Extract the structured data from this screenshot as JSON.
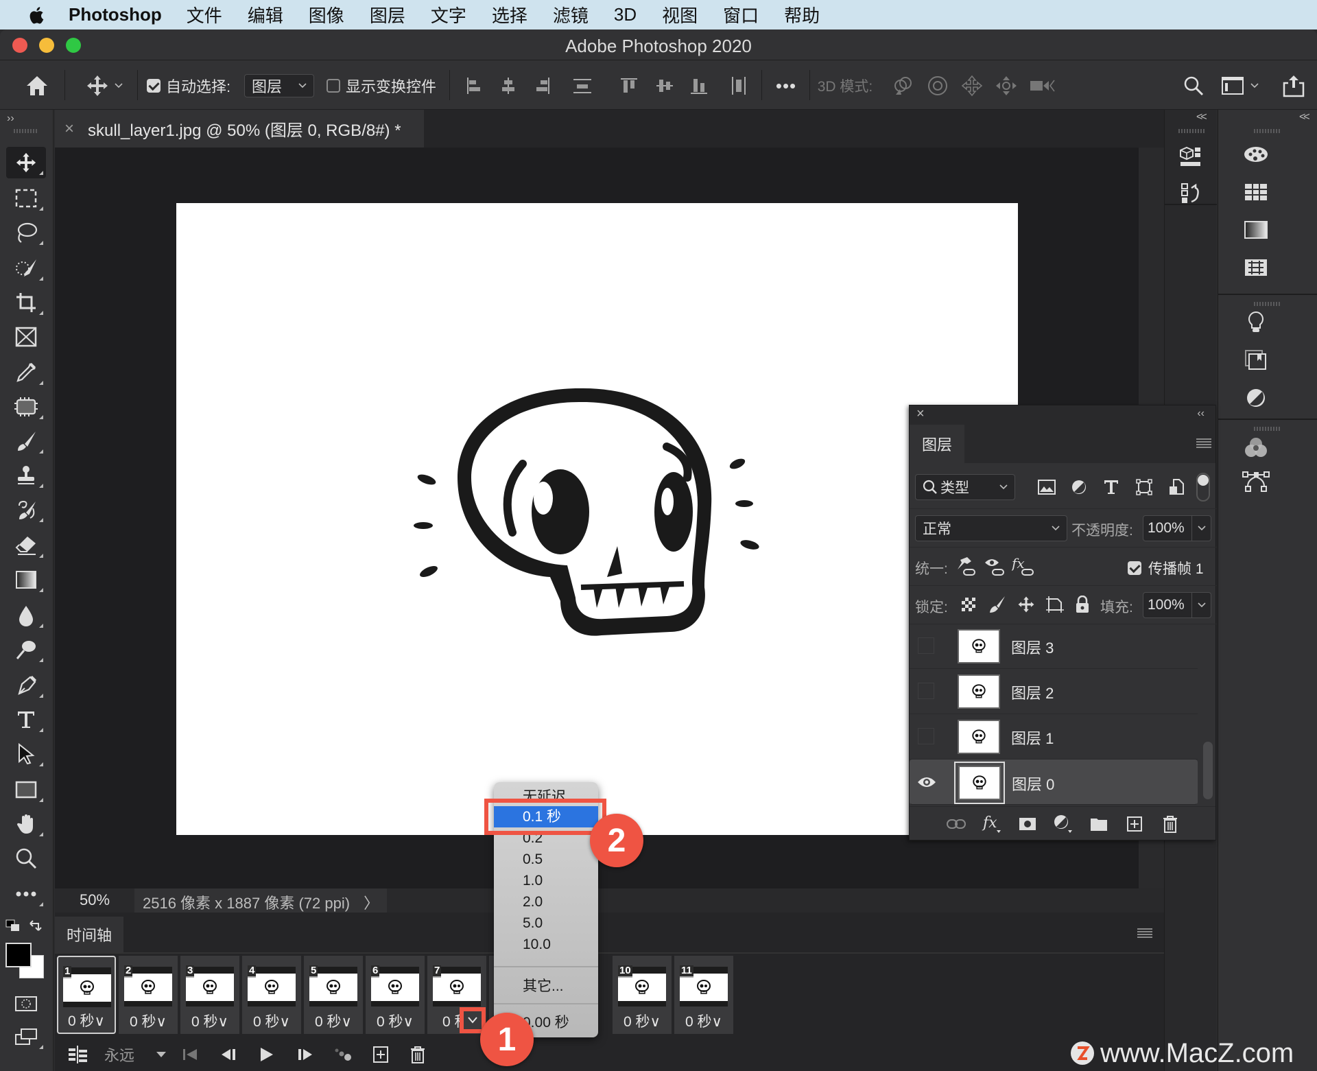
{
  "menubar": {
    "app": "Photoshop",
    "items": [
      "文件",
      "编辑",
      "图像",
      "图层",
      "文字",
      "选择",
      "滤镜",
      "3D",
      "视图",
      "窗口",
      "帮助"
    ]
  },
  "window": {
    "title": "Adobe Photoshop 2020"
  },
  "options_bar": {
    "auto_select_label": "自动选择:",
    "auto_select_checked": true,
    "auto_select_target": "图层",
    "show_transform_label": "显示变换控件",
    "show_transform_checked": false,
    "more": "•••",
    "mode_3d_label": "3D 模式:"
  },
  "document_tab": {
    "close": "×",
    "title": "skull_layer1.jpg @ 50% (图层 0, RGB/8#) *"
  },
  "toolbar": {
    "expand": "››",
    "tools": [
      "move",
      "marquee",
      "lasso",
      "quick-selection",
      "crop",
      "frame",
      "eyedropper",
      "patch",
      "brush",
      "clone-stamp",
      "history-brush",
      "eraser",
      "gradient",
      "blur",
      "dodge",
      "pen",
      "type",
      "path-selection",
      "rectangle",
      "hand",
      "zoom",
      "more"
    ],
    "foreground_color": "#000000",
    "background_color": "#ffffff"
  },
  "status_bar": {
    "zoom": "50%",
    "doc_info": "2516 像素 x 1887 像素 (72 ppi)",
    "arrow": "〉"
  },
  "timeline": {
    "tab": "时间轴",
    "frames": [
      {
        "num": "1",
        "delay": "0 秒∨"
      },
      {
        "num": "2",
        "delay": "0 秒∨"
      },
      {
        "num": "3",
        "delay": "0 秒∨"
      },
      {
        "num": "4",
        "delay": "0 秒∨"
      },
      {
        "num": "5",
        "delay": "0 秒∨"
      },
      {
        "num": "6",
        "delay": "0 秒∨"
      },
      {
        "num": "7",
        "delay": "0 秒"
      },
      {
        "num": "10",
        "delay": "0 秒∨"
      },
      {
        "num": "11",
        "delay": "0 秒∨"
      }
    ],
    "loop": "永远"
  },
  "delay_menu": {
    "items": [
      "无延迟",
      "0.1 秒",
      "0.2",
      "0.5",
      "1.0",
      "2.0",
      "5.0",
      "10.0"
    ],
    "highlighted": "0.1 秒",
    "other": "其它...",
    "current": "0.00 秒"
  },
  "callouts": {
    "step1": "1",
    "step2": "2"
  },
  "layers_panel": {
    "close": "×",
    "collapse": "‹‹",
    "tab": "图层",
    "filter_kind": "类型",
    "blend_mode": "正常",
    "opacity_label": "不透明度:",
    "opacity_value": "100%",
    "unify_label": "统一:",
    "propagate_label": "传播帧 1",
    "propagate_checked": true,
    "lock_label": "锁定:",
    "fill_label": "填充:",
    "fill_value": "100%",
    "layers": [
      {
        "name": "图层 3",
        "visible": false,
        "selected": false
      },
      {
        "name": "图层 2",
        "visible": false,
        "selected": false
      },
      {
        "name": "图层 1",
        "visible": false,
        "selected": false
      },
      {
        "name": "图层 0",
        "visible": true,
        "selected": true
      }
    ]
  },
  "watermark": {
    "text": "www.MacZ.com"
  }
}
